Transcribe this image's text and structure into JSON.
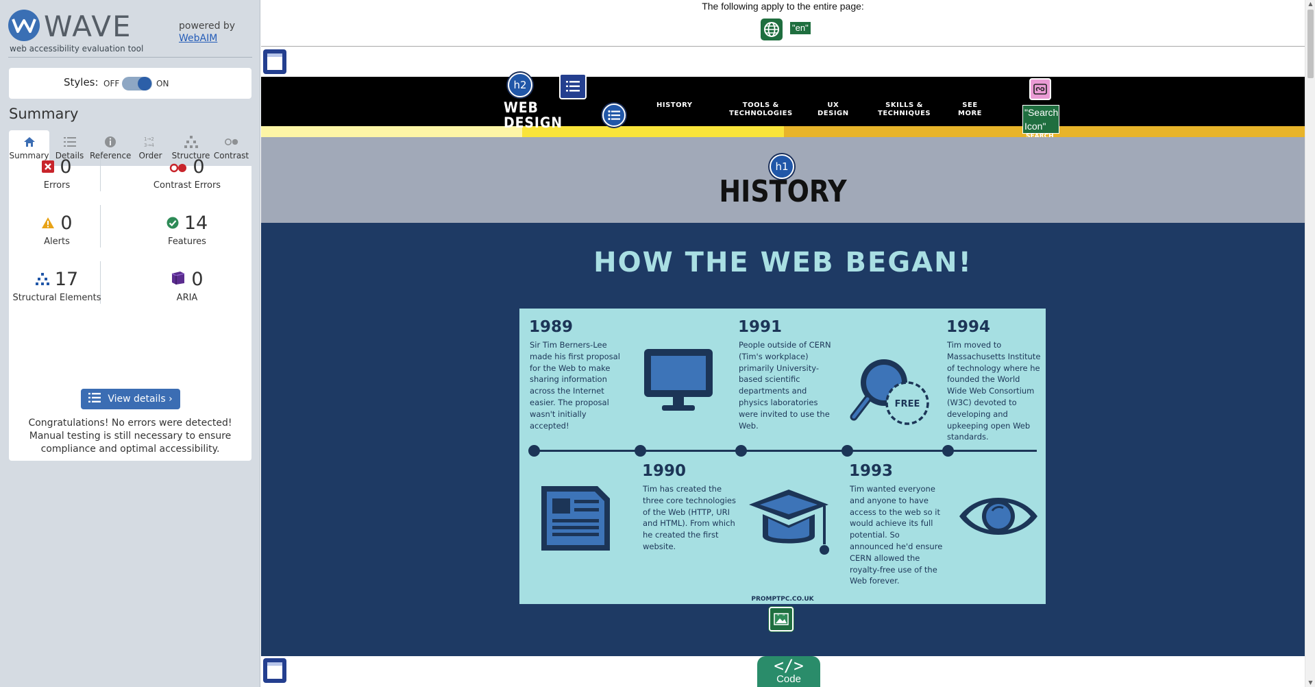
{
  "wave": {
    "title": "WAVE",
    "tagline": "web accessibility evaluation tool",
    "powered_by": "powered by",
    "webaim_link": "WebAIM",
    "styles_label": "Styles:",
    "styles_off": "OFF",
    "styles_on": "ON",
    "styles_enabled": true,
    "summary_heading": "Summary",
    "tabs": [
      {
        "label": "Summary",
        "icon": "home-icon",
        "active": true
      },
      {
        "label": "Details",
        "icon": "list-icon",
        "active": false
      },
      {
        "label": "Reference",
        "icon": "info-icon",
        "active": false
      },
      {
        "label": "Order",
        "icon": "order-icon",
        "active": false
      },
      {
        "label": "Structure",
        "icon": "structure-icon",
        "active": false
      },
      {
        "label": "Contrast",
        "icon": "contrast-icon",
        "active": false
      }
    ],
    "stats": {
      "errors": {
        "value": "0",
        "label": "Errors"
      },
      "contrast_errors": {
        "value": "0",
        "label": "Contrast Errors"
      },
      "alerts": {
        "value": "0",
        "label": "Alerts"
      },
      "features": {
        "value": "14",
        "label": "Features"
      },
      "structural": {
        "value": "17",
        "label": "Structural Elements"
      },
      "aria": {
        "value": "0",
        "label": "ARIA"
      }
    },
    "view_details": "View details ›",
    "congrats": "Congratulations! No errors were detected! Manual testing is still necessary to ensure compliance and optimal accessibility."
  },
  "page": {
    "notice": "The following apply to the entire page:",
    "lang_tag": "\"en\"",
    "logo_line1": "WEB",
    "logo_line2": "DESIGN",
    "h2_badge": "h2",
    "h1_badge": "h1",
    "nav": [
      {
        "line1": "HISTORY",
        "line2": ""
      },
      {
        "line1": "TOOLS &",
        "line2": "TECHNOLOGIES"
      },
      {
        "line1": "UX",
        "line2": "DESIGN"
      },
      {
        "line1": "SKILLS &",
        "line2": "TECHNIQUES"
      },
      {
        "line1": "SEE",
        "line2": "MORE"
      }
    ],
    "search_alt": "\"Search Icon\"",
    "search_under": "SEARCH",
    "hero_title": "HISTORY",
    "section_title": "HOW THE WEB BEGAN!",
    "code_label": "Code",
    "code_symbol": "</>"
  },
  "infographic": {
    "entries": [
      {
        "year": "1989",
        "text": "Sir Tim Berners-Lee made his first proposal for the Web to make sharing information across the Internet easier. The proposal wasn't initially accepted!"
      },
      {
        "year": "1990",
        "text": "Tim has created the three core technologies of the Web (HTTP, URI and HTML). From which he created the first website."
      },
      {
        "year": "1991",
        "text": "People outside of CERN (Tim's workplace) primarily University-based scientific departments and physics laboratories were invited to use the Web."
      },
      {
        "year": "1993",
        "text": "Tim wanted everyone and anyone to have access to the web so it would achieve its full potential. So announced he'd ensure CERN allowed the royalty-free use of the Web forever."
      },
      {
        "year": "1994",
        "text": "Tim moved to Massachusetts Institute of technology where he founded the World Wide Web Consortium (W3C) devoted to developing and upkeeping open Web standards."
      }
    ],
    "free_label": "FREE",
    "credit": "PROMPTPC.CO.UK"
  },
  "colors": {
    "wave_blue": "#3b6db3",
    "navbar": "#000000",
    "hero_gray": "#a1a9b8",
    "dark_section": "#1e3a64",
    "infographic_bg": "#a6dfe2",
    "infographic_ink": "#1c3557",
    "feature_green": "#1f6e3f",
    "code_green": "#2a8c6a",
    "yellow_1": "#fdf5a6",
    "yellow_2": "#f9e43a",
    "yellow_3": "#e8b42a"
  }
}
